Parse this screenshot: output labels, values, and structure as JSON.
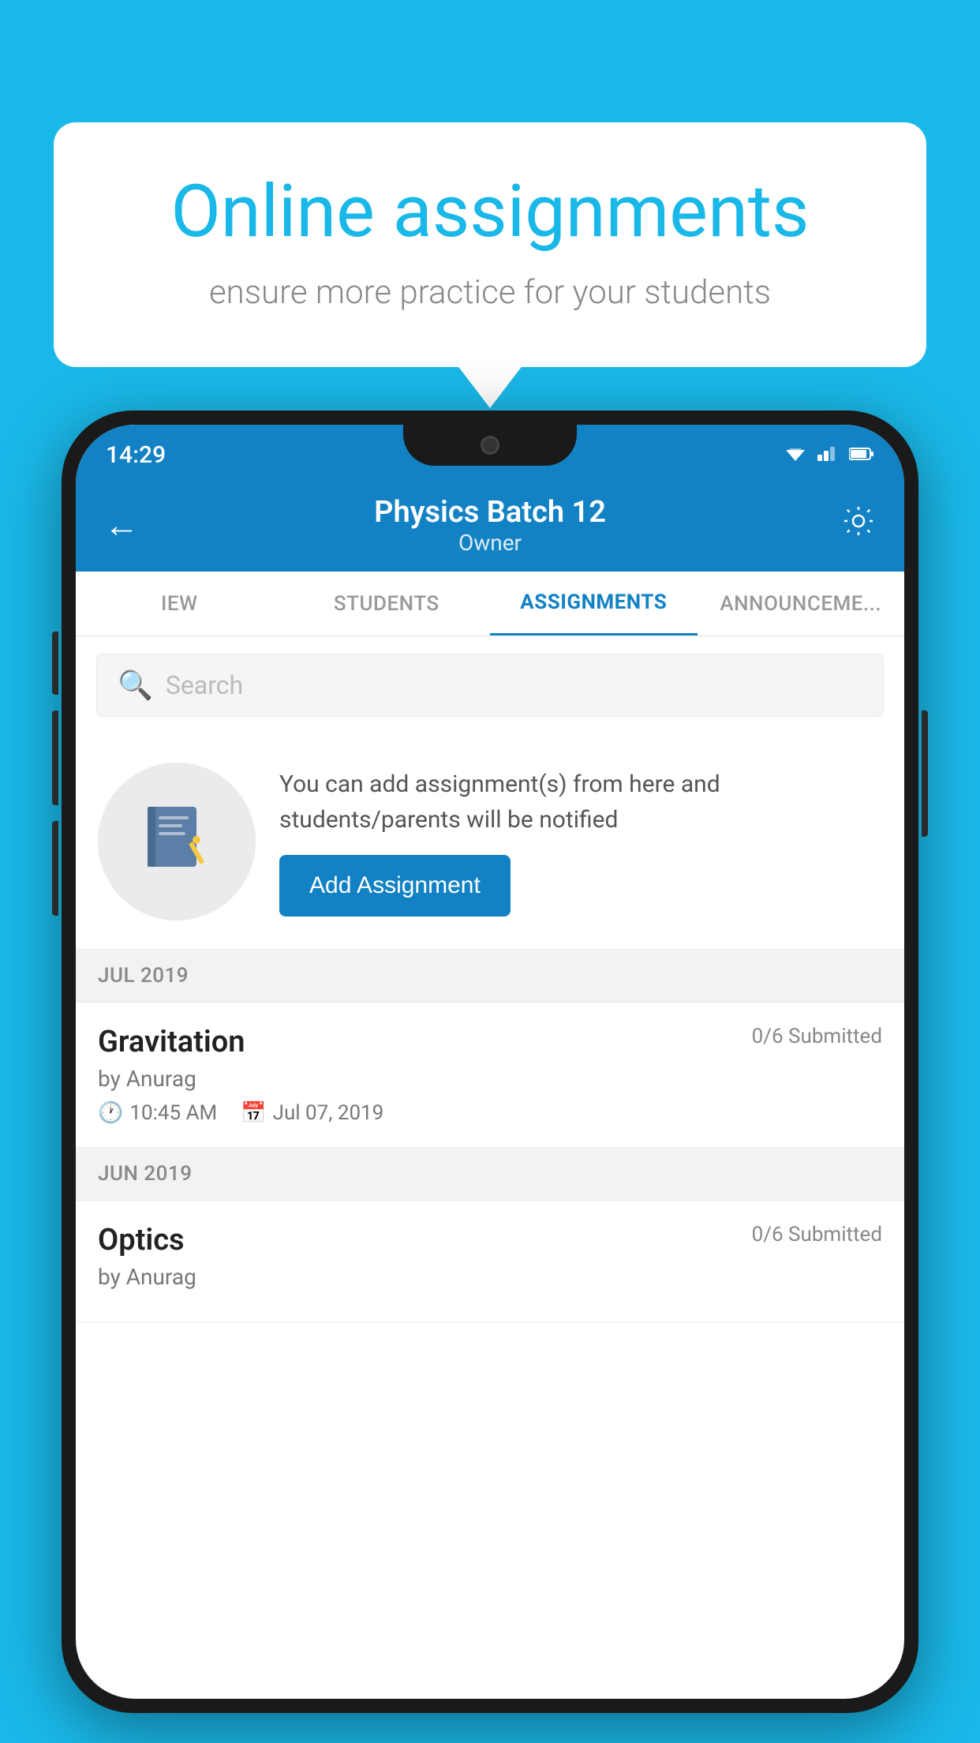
{
  "background_color": "#1ab8e8",
  "speech_bubble": {
    "title": "Online assignments",
    "subtitle": "ensure more practice for your students"
  },
  "status_bar": {
    "time": "14:29",
    "wifi_icon": "▼▲",
    "signal_icon": "▲",
    "battery_icon": "▐"
  },
  "app_header": {
    "back_icon": "←",
    "title": "Physics Batch 12",
    "subtitle": "Owner",
    "settings_icon": "⚙"
  },
  "tabs": [
    {
      "label": "IEW",
      "active": false
    },
    {
      "label": "STUDENTS",
      "active": false
    },
    {
      "label": "ASSIGNMENTS",
      "active": true
    },
    {
      "label": "ANNOUNCEMENTS",
      "active": false
    }
  ],
  "search": {
    "placeholder": "Search",
    "icon": "🔍"
  },
  "info_card": {
    "description": "You can add assignment(s) from here and students/parents will be notified",
    "add_button_label": "Add Assignment"
  },
  "sections": [
    {
      "header": "JUL 2019",
      "assignments": [
        {
          "title": "Gravitation",
          "submitted": "0/6 Submitted",
          "author": "by Anurag",
          "time": "10:45 AM",
          "date": "Jul 07, 2019"
        }
      ]
    },
    {
      "header": "JUN 2019",
      "assignments": [
        {
          "title": "Optics",
          "submitted": "0/6 Submitted",
          "author": "by Anurag",
          "time": "",
          "date": ""
        }
      ]
    }
  ]
}
